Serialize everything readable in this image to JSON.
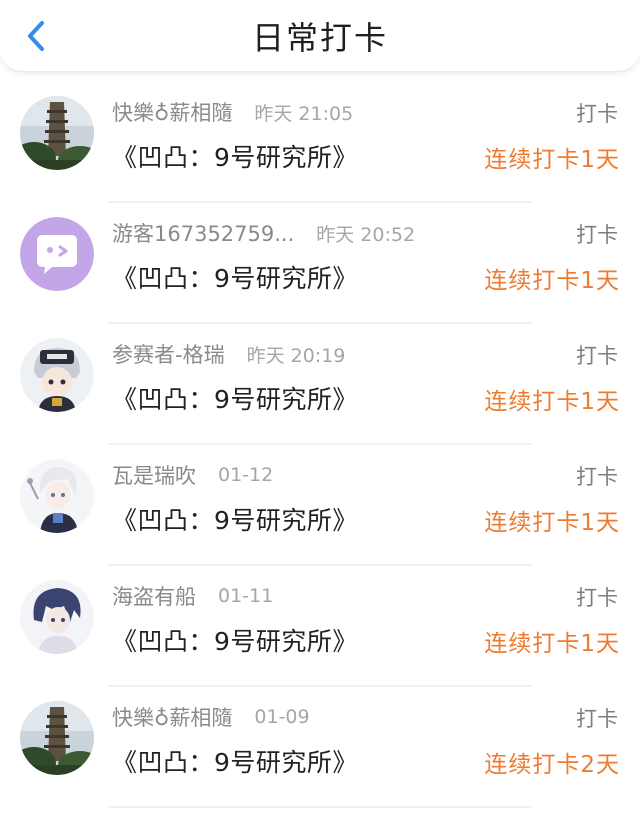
{
  "header": {
    "back_icon": "chevron-left-icon",
    "title": "日常打卡",
    "accent_color": "#2f8fe8"
  },
  "entries": [
    {
      "user": "快樂♁薪相隨",
      "time": "昨天 21:05",
      "book": "《凹凸：9号研究所》",
      "checkin": "打卡",
      "streak": "连续打卡1天",
      "avatar": "pagoda-photo"
    },
    {
      "user": "游客167352759...",
      "time": "昨天 20:52",
      "book": "《凹凸：9号研究所》",
      "checkin": "打卡",
      "streak": "连续打卡1天",
      "avatar": "chat-bubble-default"
    },
    {
      "user": "参赛者-格瑞",
      "time": "昨天 20:19",
      "book": "《凹凸：9号研究所》",
      "checkin": "打卡",
      "streak": "连续打卡1天",
      "avatar": "anime-boy-cap"
    },
    {
      "user": "瓦是瑞吹",
      "time": "01-12",
      "book": "《凹凸：9号研究所》",
      "checkin": "打卡",
      "streak": "连续打卡1天",
      "avatar": "anime-white-hair"
    },
    {
      "user": "海盗有船",
      "time": "01-11",
      "book": "《凹凸：9号研究所》",
      "checkin": "打卡",
      "streak": "连续打卡1天",
      "avatar": "anime-navy-hair"
    },
    {
      "user": "快樂♁薪相隨",
      "time": "01-09",
      "book": "《凹凸：9号研究所》",
      "checkin": "打卡",
      "streak": "连续打卡2天",
      "avatar": "pagoda-photo"
    }
  ],
  "colors": {
    "streak": "#f07a2e",
    "username": "#8a8a8a",
    "time": "#a6a6a6"
  }
}
